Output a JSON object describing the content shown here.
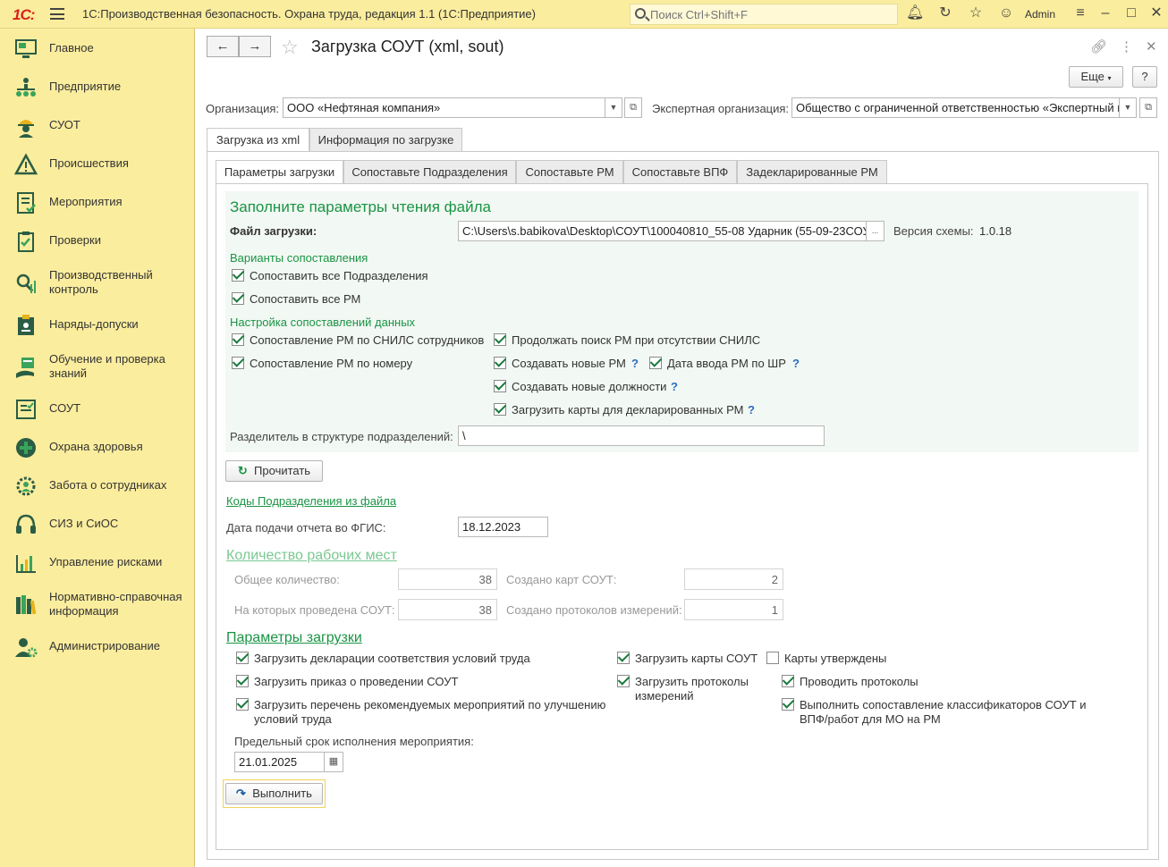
{
  "app": {
    "logo": "1С:",
    "title": "1С:Производственная безопасность. Охрана труда, редакция 1.1  (1С:Предприятие)",
    "search_placeholder": "Поиск Ctrl+Shift+F",
    "user": "Admin"
  },
  "sidebar": {
    "items": [
      {
        "label": "Главное",
        "icon": "monitor-icon"
      },
      {
        "label": "Предприятие",
        "icon": "org-tree-icon"
      },
      {
        "label": "СУОТ",
        "icon": "worker-helmet-icon"
      },
      {
        "label": "Происшествия",
        "icon": "warning-triangle-icon"
      },
      {
        "label": "Мероприятия",
        "icon": "checklist-icon"
      },
      {
        "label": "Проверки",
        "icon": "clipboard-icon"
      },
      {
        "label": "Производственный контроль",
        "icon": "magnifier-chart-icon"
      },
      {
        "label": "Наряды-допуски",
        "icon": "permit-badge-icon"
      },
      {
        "label": "Обучение и проверка знаний",
        "icon": "hand-book-icon"
      },
      {
        "label": "СОУТ",
        "icon": "document-check-icon"
      },
      {
        "label": "Охрана здоровья",
        "icon": "medical-cross-icon"
      },
      {
        "label": "Забота о сотрудниках",
        "icon": "people-gear-icon"
      },
      {
        "label": "СИЗ и СиОС",
        "icon": "headphones-icon"
      },
      {
        "label": "Управление рисками",
        "icon": "bar-chart-icon"
      },
      {
        "label": "Нормативно-справочная информация",
        "icon": "books-icon"
      },
      {
        "label": "Администрирование",
        "icon": "user-gear-icon"
      }
    ]
  },
  "form": {
    "title": "Загрузка СОУТ (xml, sout)",
    "more_label": "Еще",
    "help_label": "?",
    "org_label": "Организация:",
    "org_value": "ООО «Нефтяная компания»",
    "expert_label": "Экспертная организация:",
    "expert_value": "Общество с ограниченной ответственностью «Экспертный ц",
    "tabs": [
      "Загрузка из xml",
      "Информация по загрузке"
    ],
    "subtabs": [
      "Параметры загрузки",
      "Сопоставьте Подразделения",
      "Сопоставьте РМ",
      "Сопоставьте ВПФ",
      "Задекларированные РМ"
    ],
    "read_heading": "Заполните параметры чтения файла",
    "file_label": "Файл загрузки:",
    "file_value": "C:\\Users\\s.babikova\\Desktop\\СОУТ\\100040810_55-08 Ударник (55-09-23СОУТ",
    "file_btn": "...",
    "schema_label": "Версия схемы:",
    "schema_value": "1.0.18",
    "match_heading": "Варианты сопоставления",
    "cb_all_units": "Сопоставить все Подразделения",
    "cb_all_rm": "Сопоставить все РМ",
    "data_heading": "Настройка сопоставлений данных",
    "cb_snils": "Сопоставление РМ по СНИЛС сотрудников",
    "cb_number": "Сопоставление РМ по номеру",
    "cb_continue": "Продолжать поиск РМ при отсутствии СНИЛС",
    "cb_new_rm": "Создавать новые РМ",
    "cb_date_rm": "Дата ввода РМ по ШР",
    "cb_new_pos": "Создавать новые должности",
    "cb_load_cards": "Загрузить карты для декларированных РМ",
    "q": "?",
    "separator_label": "Разделитель в структуре подразделений:",
    "separator_value": "\\",
    "read_btn": "Прочитать",
    "codes_link": "Коды Подразделения из файла",
    "report_date_label": "Дата подачи отчета во ФГИС:",
    "report_date_value": "18.12.2023",
    "count_heading": "Количество рабочих мест",
    "total_label": "Общее количество:",
    "total_value": "38",
    "conducted_label": "На которых проведена СОУТ:",
    "conducted_value": "38",
    "cards_created_label": "Создано карт СОУТ:",
    "cards_created_value": "2",
    "protocols_created_label": "Создано протоколов измерений:",
    "protocols_created_value": "1",
    "load_heading": "Параметры загрузки",
    "cb_decl": "Загрузить декларации соответствия условий труда",
    "cb_order": "Загрузить приказ о проведении СОУТ",
    "cb_measures": "Загрузить перечень рекомендуемых мероприятий по улучшению условий труда",
    "cb_cards": "Загрузить карты СОУТ",
    "cb_protocols": "Загрузить протоколы измерений",
    "cb_approved": "Карты утверждены",
    "cb_post": "Проводить протоколы",
    "cb_classif": "Выполнить сопоставление классификаторов СОУТ и ВПФ/работ для МО на РМ",
    "deadline_label": "Предельный срок исполнения мероприятия:",
    "deadline_value": "21.01.2025",
    "run_btn": "Выполнить"
  }
}
